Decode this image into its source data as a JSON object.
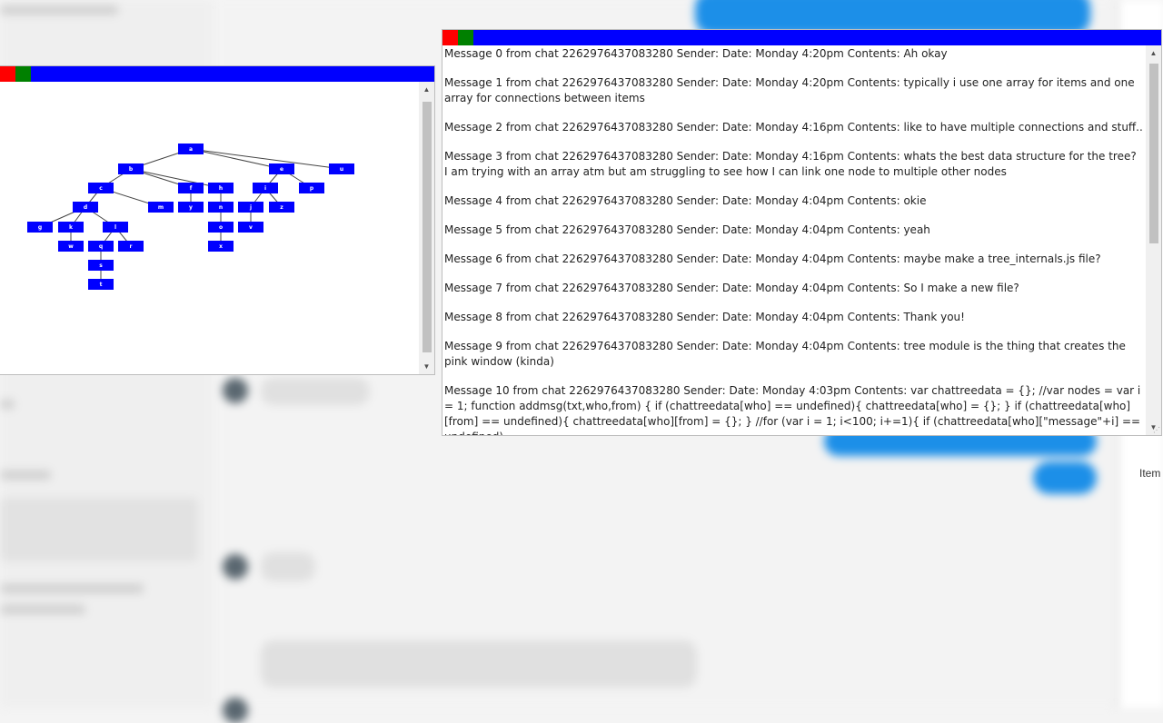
{
  "background": {
    "right_panel_label": "Item"
  },
  "tree_window": {
    "nodes": [
      {
        "id": "n_root",
        "label": "a"
      },
      {
        "id": "n_b",
        "label": "b"
      },
      {
        "id": "n_c",
        "label": "c"
      },
      {
        "id": "n_d",
        "label": "d"
      },
      {
        "id": "n_e",
        "label": "e"
      },
      {
        "id": "n_f",
        "label": "f"
      },
      {
        "id": "n_g",
        "label": "g"
      },
      {
        "id": "n_h",
        "label": "h"
      },
      {
        "id": "n_i",
        "label": "i"
      },
      {
        "id": "n_j",
        "label": "j"
      },
      {
        "id": "n_k",
        "label": "k"
      },
      {
        "id": "n_l",
        "label": "l"
      },
      {
        "id": "n_m",
        "label": "m"
      },
      {
        "id": "n_n",
        "label": "n"
      },
      {
        "id": "n_o",
        "label": "o"
      },
      {
        "id": "n_p",
        "label": "p"
      },
      {
        "id": "n_q",
        "label": "q"
      },
      {
        "id": "n_r",
        "label": "r"
      },
      {
        "id": "n_s",
        "label": "s"
      },
      {
        "id": "n_t",
        "label": "t"
      },
      {
        "id": "n_u",
        "label": "u"
      },
      {
        "id": "n_v",
        "label": "v"
      },
      {
        "id": "n_w",
        "label": "w"
      },
      {
        "id": "n_x",
        "label": "x"
      },
      {
        "id": "n_y",
        "label": "y"
      },
      {
        "id": "n_z",
        "label": "z"
      },
      {
        "id": "n_aa",
        "label": "x"
      }
    ]
  },
  "messages_window": {
    "messages": [
      "Message 0 from chat 2262976437083280 Sender: Date: Monday 4:20pm Contents: Ah okay",
      "Message 1 from chat 2262976437083280 Sender: Date: Monday 4:20pm Contents: typically i use one array for items and one array for connections between items",
      "Message 2 from chat 2262976437083280 Sender: Date: Monday 4:16pm Contents: like to have multiple connections and stuff...",
      "Message 3 from chat 2262976437083280 Sender: Date: Monday 4:16pm Contents: whats the best data structure for the tree? I am trying with an array atm but am struggling to see how I can link one node to multiple other nodes",
      "Message 4 from chat 2262976437083280 Sender: Date: Monday 4:04pm Contents: okie",
      "Message 5 from chat 2262976437083280 Sender: Date: Monday 4:04pm Contents: yeah",
      "Message 6 from chat 2262976437083280 Sender: Date: Monday 4:04pm Contents: maybe make a tree_internals.js file?",
      "Message 7 from chat 2262976437083280 Sender: Date: Monday 4:04pm Contents: So I make a new file?",
      "Message 8 from chat 2262976437083280 Sender: Date: Monday 4:04pm Contents: Thank you!",
      "Message 9 from chat 2262976437083280 Sender: Date: Monday 4:04pm Contents: tree module is the thing that creates the pink window (kinda)",
      "Message 10 from chat 2262976437083280 Sender: Date: Monday 4:03pm Contents: var chattreedata = {}; //var nodes = var i = 1; function addmsg(txt,who,from) { if (chattreedata[who] == undefined){ chattreedata[who] = {}; } if (chattreedata[who][from] == undefined){ chattreedata[who][from] = {}; } //for (var i = 1; i<100; i+=1){ if (chattreedata[who][\"message\"+i] == undefined)"
    ]
  },
  "colors": {
    "titlebar": "#0000ff",
    "close_button": "#ff0000",
    "minimize_button": "#008000",
    "tree_node": "#0000ff",
    "chat_bubble": "#1c8fe8"
  }
}
